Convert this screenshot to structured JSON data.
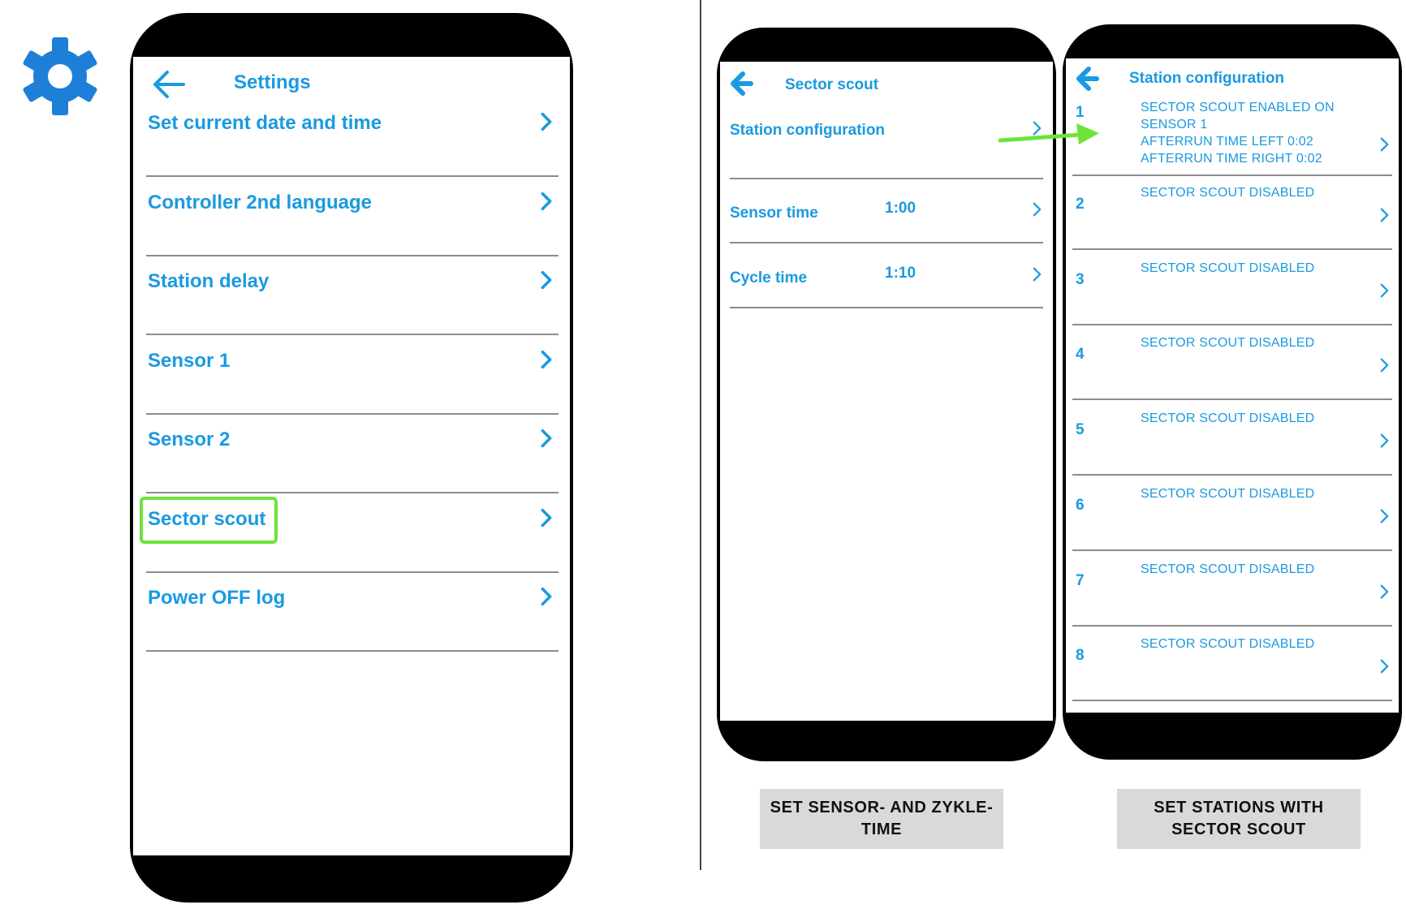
{
  "colors": {
    "accent": "#1a9ae0",
    "highlight": "#6ee33a",
    "caption_bg": "#d9d9d9"
  },
  "icons": {
    "settings": "gear-icon",
    "back": "back-arrow-icon",
    "row": "chevron-right-icon"
  },
  "settings_screen": {
    "title": "Settings",
    "items": [
      {
        "label": "Set current date and time"
      },
      {
        "label": "Controller 2nd language"
      },
      {
        "label": "Station delay"
      },
      {
        "label": "Sensor 1"
      },
      {
        "label": "Sensor 2"
      },
      {
        "label": "Sector scout",
        "highlighted": true
      },
      {
        "label": "Power OFF log"
      }
    ]
  },
  "sector_scout_screen": {
    "title": "Sector scout",
    "items": [
      {
        "label": "Station configuration",
        "value": ""
      },
      {
        "label": "Sensor time",
        "value": "1:00"
      },
      {
        "label": "Cycle time",
        "value": "1:10"
      }
    ]
  },
  "station_configuration_screen": {
    "title": "Station configuration",
    "stations": [
      {
        "number": "1",
        "lines": [
          "SECTOR SCOUT ENABLED ON",
          "SENSOR 1",
          "AFTERRUN TIME LEFT 0:02",
          "AFTERRUN TIME RIGHT 0:02"
        ]
      },
      {
        "number": "2",
        "lines": [
          "SECTOR SCOUT DISABLED"
        ]
      },
      {
        "number": "3",
        "lines": [
          "SECTOR SCOUT DISABLED"
        ]
      },
      {
        "number": "4",
        "lines": [
          "SECTOR SCOUT DISABLED"
        ]
      },
      {
        "number": "5",
        "lines": [
          "SECTOR SCOUT DISABLED"
        ]
      },
      {
        "number": "6",
        "lines": [
          "SECTOR SCOUT DISABLED"
        ]
      },
      {
        "number": "7",
        "lines": [
          "SECTOR SCOUT DISABLED"
        ]
      },
      {
        "number": "8",
        "lines": [
          "SECTOR SCOUT DISABLED"
        ]
      }
    ]
  },
  "captions": {
    "left": [
      "SET SENSOR- AND ZYKLE-",
      "TIME"
    ],
    "right": [
      "SET STATIONS WITH",
      "SECTOR SCOUT"
    ]
  }
}
